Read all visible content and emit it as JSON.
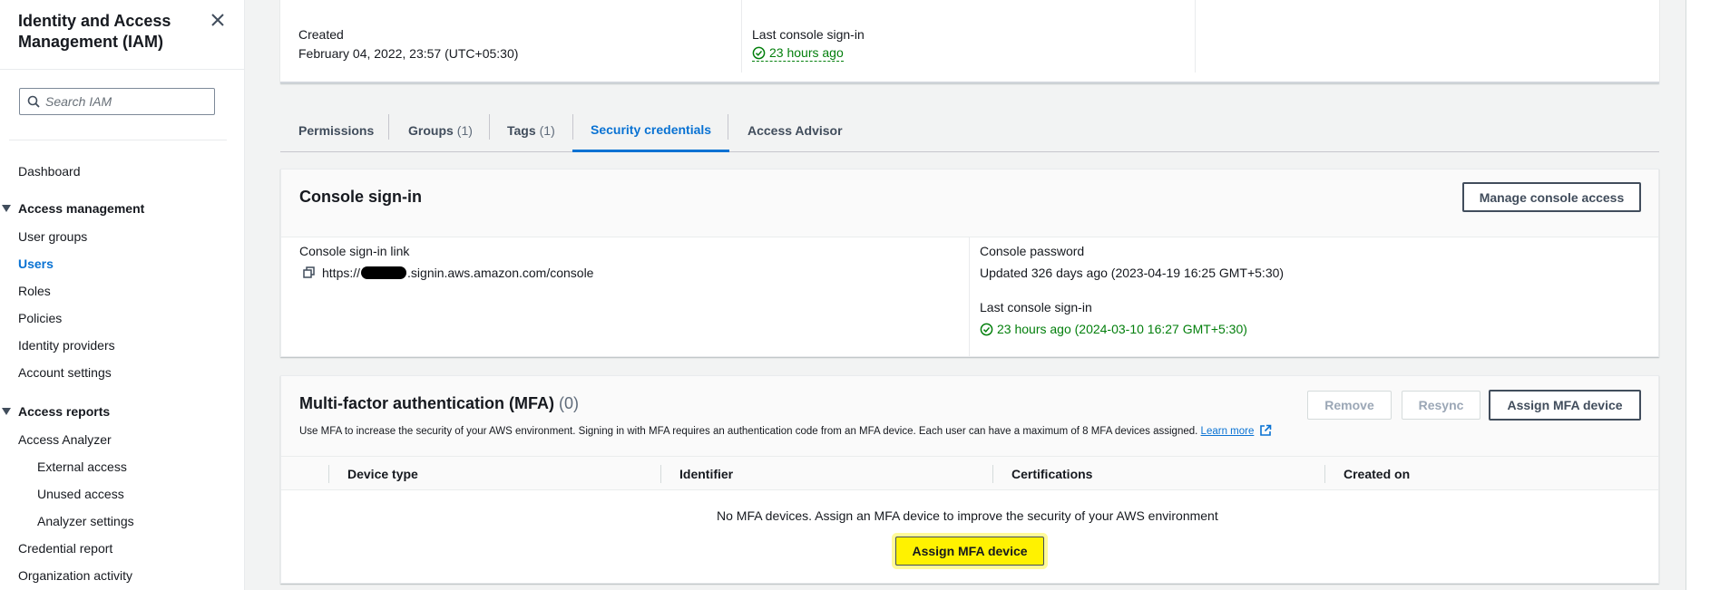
{
  "sidebar": {
    "title": "Identity and Access Management (IAM)",
    "search_placeholder": "Search IAM",
    "dashboard": "Dashboard",
    "access_management": {
      "label": "Access management",
      "items": [
        "User groups",
        "Users",
        "Roles",
        "Policies",
        "Identity providers",
        "Account settings"
      ]
    },
    "access_reports": {
      "label": "Access reports",
      "items": [
        "Access Analyzer",
        "External access",
        "Unused access",
        "Analyzer settings",
        "Credential report",
        "Organization activity"
      ]
    }
  },
  "summary": {
    "created_label": "Created",
    "created_value": "February 04, 2022, 23:57 (UTC+05:30)",
    "last_signin_label": "Last console sign-in",
    "last_signin_value": "23 hours ago"
  },
  "tabs": [
    {
      "label": "Permissions",
      "count": ""
    },
    {
      "label": "Groups",
      "count": "(1)"
    },
    {
      "label": "Tags",
      "count": "(1)"
    },
    {
      "label": "Security credentials",
      "count": ""
    },
    {
      "label": "Access Advisor",
      "count": ""
    }
  ],
  "console_signin": {
    "title": "Console sign-in",
    "manage_button": "Manage console access",
    "link_label": "Console sign-in link",
    "link_prefix": "https://",
    "link_suffix": ".signin.aws.amazon.com/console",
    "password_label": "Console password",
    "password_value": "Updated 326 days ago (2023-04-19 16:25 GMT+5:30)",
    "last_signin_label": "Last console sign-in",
    "last_signin_value": "23 hours ago (2024-03-10 16:27 GMT+5:30)"
  },
  "mfa": {
    "title": "Multi-factor authentication (MFA)",
    "count": "(0)",
    "remove_button": "Remove",
    "resync_button": "Resync",
    "assign_button": "Assign MFA device",
    "description": "Use MFA to increase the security of your AWS environment. Signing in with MFA requires an authentication code from an MFA device. Each user can have a maximum of 8 MFA devices assigned.",
    "learn_more": "Learn more",
    "columns": [
      "Device type",
      "Identifier",
      "Certifications",
      "Created on"
    ],
    "empty_message": "No MFA devices. Assign an MFA device to improve the security of your AWS environment",
    "empty_assign_button": "Assign MFA device"
  },
  "colors": {
    "link_blue": "#0972d3",
    "success_green": "#037f0c",
    "highlight_yellow": "#fff200"
  }
}
